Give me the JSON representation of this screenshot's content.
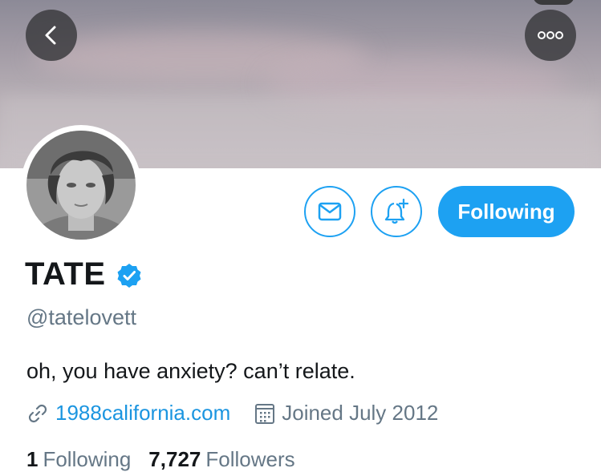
{
  "colors": {
    "accent": "#1da1f2",
    "link": "#1b95e0",
    "muted": "#657786",
    "text": "#14171a"
  },
  "nav": {
    "back_icon": "chevron-left-icon",
    "more_icon": "ellipsis-icon"
  },
  "actions": {
    "message_icon": "envelope-icon",
    "notify_icon": "bell-plus-icon",
    "follow_label": "Following"
  },
  "profile": {
    "name": "TATE",
    "verified_icon": "verified-badge-icon",
    "handle": "@tatelovett",
    "bio": "oh, you have anxiety? can’t relate.",
    "website": "1988california.com",
    "joined": "Joined July 2012"
  },
  "stats": {
    "following_count": "1",
    "following_label": "Following",
    "followers_count": "7,727",
    "followers_label": "Followers"
  }
}
